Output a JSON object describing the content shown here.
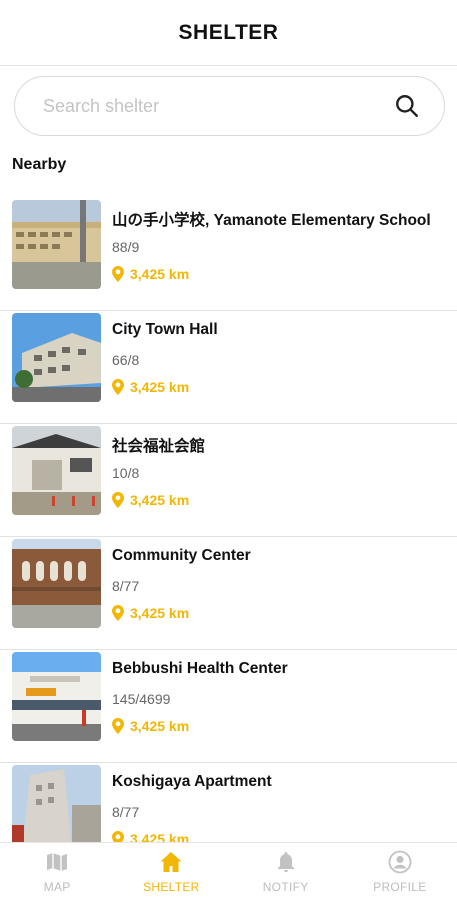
{
  "header": {
    "title": "SHELTER"
  },
  "search": {
    "placeholder": "Search shelter",
    "value": ""
  },
  "section": {
    "title": "Nearby"
  },
  "shelters": [
    {
      "name": "山の手小学校, Yamanote Elementary School",
      "code": "88/9",
      "distance": "3,425 km"
    },
    {
      "name": "City Town Hall",
      "code": "66/8",
      "distance": "3,425 km"
    },
    {
      "name": "社会福祉会館",
      "code": "10/8",
      "distance": "3,425 km"
    },
    {
      "name": "Community Center",
      "code": "8/77",
      "distance": "3,425 km"
    },
    {
      "name": "Bebbushi Health Center",
      "code": "145/4699",
      "distance": "3,425 km"
    },
    {
      "name": "Koshigaya Apartment",
      "code": "8/77",
      "distance": "3,425 km"
    }
  ],
  "tabs": [
    {
      "label": "MAP",
      "icon": "map-icon",
      "active": false
    },
    {
      "label": "SHELTER",
      "icon": "home-icon",
      "active": true
    },
    {
      "label": "NOTIFY",
      "icon": "bell-icon",
      "active": false
    },
    {
      "label": "PROFILE",
      "icon": "user-icon",
      "active": false
    }
  ],
  "colors": {
    "accent": "#f2b705",
    "inactive": "#bdbdbd",
    "divider": "#e2e2e2"
  }
}
